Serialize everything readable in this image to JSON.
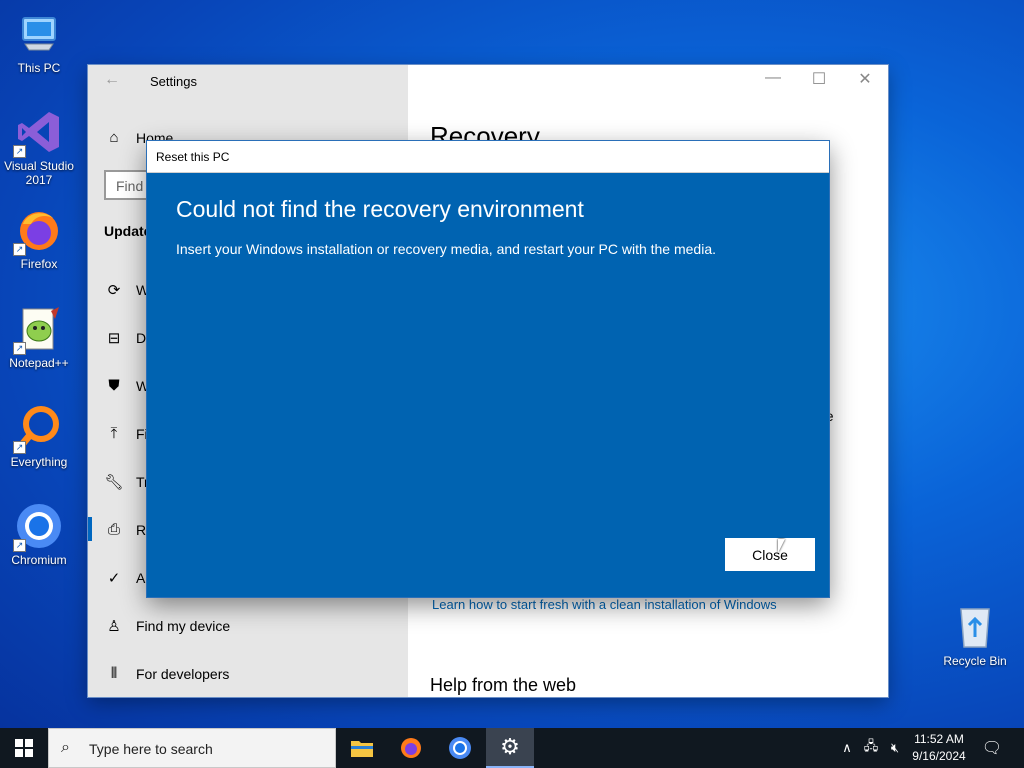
{
  "desktop": {
    "icons": [
      {
        "label": "This PC"
      },
      {
        "label": "Visual Studio 2017"
      },
      {
        "label": "Firefox"
      },
      {
        "label": "Notepad++"
      },
      {
        "label": "Everything"
      },
      {
        "label": "Chromium"
      },
      {
        "label": "Recycle Bin"
      }
    ]
  },
  "settings": {
    "title": "Settings",
    "nav": {
      "home": "Home",
      "search_placeholder": "Find",
      "section": "Update",
      "items": [
        "W",
        "De",
        "W",
        "Fil",
        "Tr",
        "Re",
        "Ac",
        "Find my device",
        "For developers"
      ]
    },
    "right": {
      "title": "Recovery",
      "partial_1": "ge",
      "partial_2": "r",
      "link": "Learn how to start fresh with a clean installation of Windows",
      "help_heading": "Help from the web"
    }
  },
  "dialog": {
    "title": "Reset this PC",
    "heading": "Could not find the recovery environment",
    "body": "Insert your Windows installation or recovery media, and restart your PC with the media.",
    "close_label": "Close"
  },
  "taskbar": {
    "search_placeholder": "Type here to search",
    "clock_time": "11:52 AM",
    "clock_date": "9/16/2024"
  }
}
